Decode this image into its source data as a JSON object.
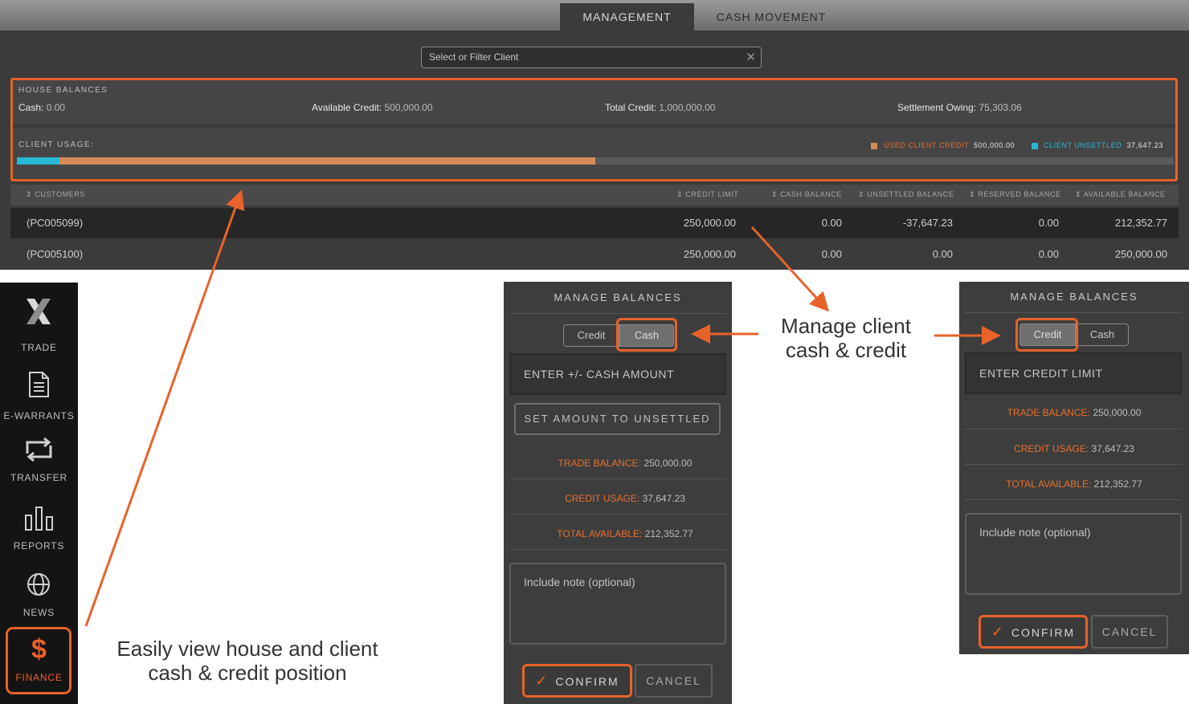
{
  "tabs": [
    "MANAGEMENT",
    "CASH MOVEMENT"
  ],
  "filter": {
    "placeholder": "Select or Filter Client"
  },
  "house_balances": {
    "title": "HOUSE BALANCES",
    "items": [
      {
        "label": "Cash:",
        "value": "0.00"
      },
      {
        "label": "Available Credit:",
        "value": "500,000.00"
      },
      {
        "label": "Total Credit:",
        "value": "1,000,000.00"
      },
      {
        "label": "Settlement Owing:",
        "value": "75,303.06"
      }
    ]
  },
  "client_usage": {
    "title": "CLIENT USAGE:",
    "used_fraction": 0.5,
    "unsettled_fraction": 0.037,
    "legend": [
      {
        "label": "USED CLIENT CREDIT",
        "value": "500,000.00",
        "color": "#d68a55"
      },
      {
        "label": "CLIENT UNSETTLED",
        "value": "37,647.23",
        "color": "#27b8d6"
      }
    ]
  },
  "table": {
    "columns": [
      "CUSTOMERS",
      "CREDIT LIMIT",
      "CASH BALANCE",
      "UNSETTLED BALANCE",
      "RESERVED BALANCE",
      "AVAILABLE BALANCE"
    ],
    "rows": [
      [
        "(PC005099)",
        "250,000.00",
        "0.00",
        "-37,647.23",
        "0.00",
        "212,352.77"
      ],
      [
        "(PC005100)",
        "250,000.00",
        "0.00",
        "0.00",
        "0.00",
        "250,000.00"
      ]
    ]
  },
  "sidebar": {
    "items": [
      {
        "label": "TRADE",
        "icon": "x-logo-icon"
      },
      {
        "label": "E-WARRANTS",
        "icon": "document-icon"
      },
      {
        "label": "TRANSFER",
        "icon": "transfer-icon"
      },
      {
        "label": "REPORTS",
        "icon": "bar-chart-icon"
      },
      {
        "label": "NEWS",
        "icon": "globe-icon"
      },
      {
        "label": "FINANCE",
        "icon": "dollar-icon"
      }
    ]
  },
  "panel_cash": {
    "title": "MANAGE BALANCES",
    "toggle": [
      "Credit",
      "Cash"
    ],
    "input_placeholder": "ENTER +/- CASH AMOUNT",
    "set_unsettled": "SET AMOUNT TO UNSETTLED",
    "stats": [
      {
        "label": "TRADE BALANCE:",
        "value": "250,000.00"
      },
      {
        "label": "CREDIT USAGE:",
        "value": "37,647.23"
      },
      {
        "label": "TOTAL AVAILABLE:",
        "value": "212,352.77"
      }
    ],
    "note_placeholder": "Include note (optional)",
    "confirm": "CONFIRM",
    "cancel": "CANCEL"
  },
  "panel_credit": {
    "title": "MANAGE BALANCES",
    "toggle": [
      "Credit",
      "Cash"
    ],
    "input_placeholder": "ENTER CREDIT LIMIT",
    "stats": [
      {
        "label": "TRADE BALANCE:",
        "value": "250,000.00"
      },
      {
        "label": "CREDIT USAGE:",
        "value": "37,647.23"
      },
      {
        "label": "TOTAL AVAILABLE:",
        "value": "212,352.77"
      }
    ],
    "note_placeholder": "Include note (optional)",
    "confirm": "CONFIRM",
    "cancel": "CANCEL"
  },
  "callouts": {
    "manage_line1": "Manage client",
    "manage_line2": "cash & credit",
    "view_line1": "Easily view house and client",
    "view_line2": "cash & credit position"
  },
  "colors": {
    "accent": "#e8622a",
    "used": "#d68a55",
    "unsettled": "#27b8d6"
  }
}
